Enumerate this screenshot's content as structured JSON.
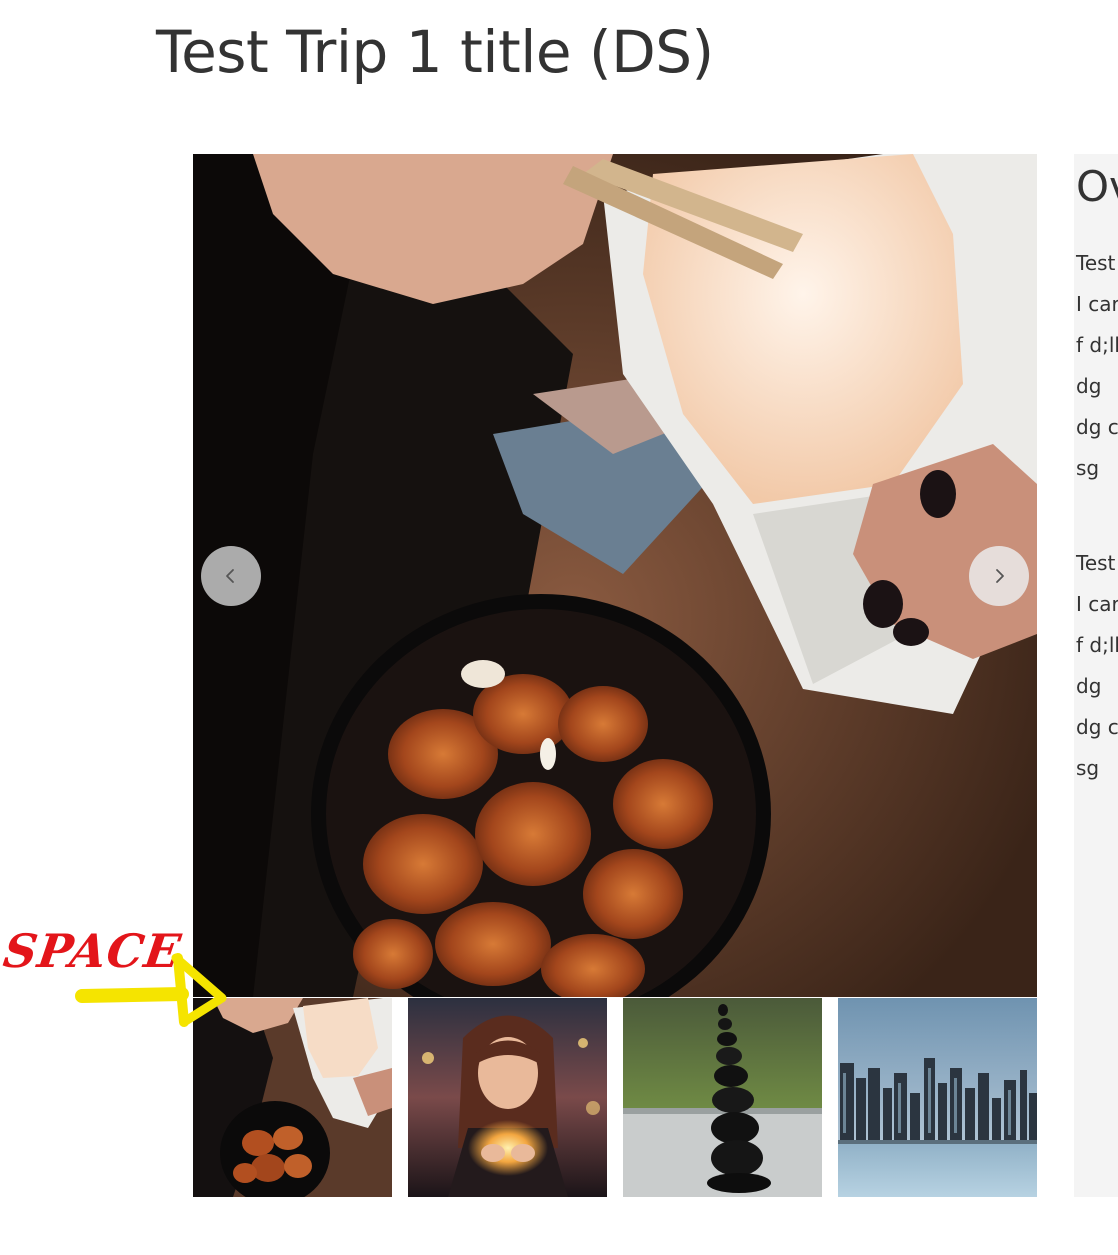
{
  "page": {
    "title": "Test Trip 1 title (DS)"
  },
  "carousel": {
    "prev_icon": "chevron-left-icon",
    "next_icon": "chevron-right-icon",
    "thumbnails": [
      {
        "name": "thumbnail-food"
      },
      {
        "name": "thumbnail-woman-lights"
      },
      {
        "name": "thumbnail-stone-stack"
      },
      {
        "name": "thumbnail-city-skyline"
      }
    ]
  },
  "overview": {
    "title": "Ov",
    "lines": [
      "Test",
      "I car",
      "f d;lk",
      "dg",
      "dg c",
      "sg",
      "Test",
      "I car",
      "f d;lk",
      "dg",
      "dg c",
      "sg"
    ]
  },
  "annotation": {
    "label": "SPACE",
    "color": "#e3151a",
    "arrow_color": "#f5e400"
  }
}
